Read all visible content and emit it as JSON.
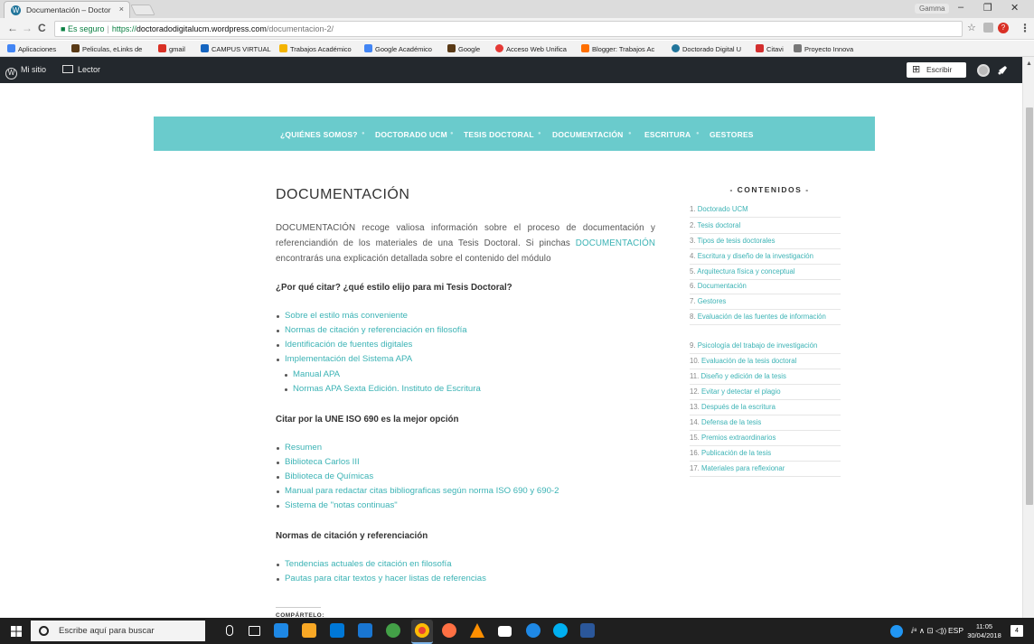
{
  "browser": {
    "tab_title": "Documentación – Doctor",
    "tab_close": "×",
    "profile": "Gamma",
    "win_min": "–",
    "win_max": "❐",
    "win_close": "✕",
    "nav_back": "←",
    "nav_forward": "→",
    "nav_reload": "C",
    "secure_label": "Es seguro",
    "url_scheme": "https://",
    "url_host": "doctoradodigitalucm.wordpress.com",
    "url_path": "/documentacion-2/",
    "star": "☆",
    "menu": "⋮",
    "bookmarks": [
      {
        "label": "Aplicaciones",
        "color": "#4285f4"
      },
      {
        "label": "Peliculas, eLinks de",
        "color": "#5a3a16"
      },
      {
        "label": "gmail",
        "color": "#d93025"
      },
      {
        "label": "CAMPUS VIRTUAL",
        "color": "#1565c0"
      },
      {
        "label": "Trabajos Académico",
        "color": "#f4b400"
      },
      {
        "label": "Google Académico",
        "color": "#4285f4"
      },
      {
        "label": "Google",
        "color": "#5a3a16"
      },
      {
        "label": "Acceso Web Unifica",
        "color": "#e53935"
      },
      {
        "label": "Blogger: Trabajos Ac",
        "color": "#ff6f00"
      },
      {
        "label": "Doctorado Digital U",
        "color": "#21759b"
      },
      {
        "label": "Citavi",
        "color": "#d32f2f"
      },
      {
        "label": "Proyecto Innova",
        "color": "#777777"
      }
    ]
  },
  "wpbar": {
    "my_site": "Mi sitio",
    "reader": "Lector",
    "write": "Escribir"
  },
  "site_nav": [
    "¿QUIÉNES SOMOS?",
    "DOCTORADO UCM",
    "TESIS DOCTORAL",
    "DOCUMENTACIÓN",
    "ESCRITURA",
    "GESTORES"
  ],
  "content": {
    "title": "DOCUMENTACIÓN",
    "intro_pre": "DOCUMENTACIÓN recoge valiosa información sobre el proceso de documentación y referenciandión de los materiales de una Tesis Doctoral. Si pinchas ",
    "intro_link": "DOCUMENTACIÓN",
    "intro_post": " encontrarás una explicación detallada sobre el contenido del módulo",
    "section1_heading": "¿Por qué citar? ¿qué estilo elijo para mi Tesis Doctoral?",
    "section1_items": [
      "Sobre el estilo más conveniente",
      "Normas de citación y referenciación en filosofía",
      "Identificación de fuentes digitales",
      "Implementación del Sistema APA"
    ],
    "section1_subitems": [
      "Manual APA",
      "Normas APA Sexta Edición. Instituto de Escritura"
    ],
    "section2_heading": "Citar por la UNE ISO 690 es la mejor opción",
    "section2_items": [
      "Resumen",
      "Biblioteca Carlos III",
      "Biblioteca de Químicas",
      "Manual para redactar citas bibliograficas según norma ISO 690 y 690-2",
      "Sistema de \"notas continuas\""
    ],
    "section3_heading": "Normas de citación y referenciación",
    "section3_items": [
      "Tendencias actuales de citación en filosofía",
      "Pautas para citar textos y hacer listas de referencias"
    ],
    "share_label": "COMPÁRTELO:"
  },
  "sidebar": {
    "title": "- CONTENIDOS -",
    "items": [
      {
        "n": "1.",
        "label": "Doctorado UCM"
      },
      {
        "n": "2.",
        "label": "Tesis doctoral"
      },
      {
        "n": "3.",
        "label": "Tipos de tesis doctorales"
      },
      {
        "n": "4.",
        "label": "Escritura y diseño de la investigación"
      },
      {
        "n": "5.",
        "label": "Arquitectura física y conceptual"
      },
      {
        "n": "6.",
        "label": "Documentación"
      },
      {
        "n": "7.",
        "label": "Gestores"
      },
      {
        "n": "8.",
        "label": "Evaluación de las fuentes de información"
      },
      {
        "n": "9.",
        "label": "Psicología del trabajo de investigación"
      },
      {
        "n": "10.",
        "label": "Evaluación de la tesis doctoral"
      },
      {
        "n": "11.",
        "label": "Diseño y edición de la tesis"
      },
      {
        "n": "12.",
        "label": "Evitar y detectar el plagio"
      },
      {
        "n": "13.",
        "label": "Después de la escritura"
      },
      {
        "n": "14.",
        "label": "Defensa de la tesis"
      },
      {
        "n": "15.",
        "label": "Premios extraordinarios"
      },
      {
        "n": "16.",
        "label": "Publicación de la tesis"
      },
      {
        "n": "17.",
        "label": "Materiales para reflexionar"
      }
    ]
  },
  "taskbar": {
    "search_placeholder": "Escribe aquí para buscar",
    "lang": "ESP",
    "time": "11:05",
    "date": "30/04/2018",
    "tray_icons": "ⅈ⁸ ∧ ⊡ ◁)) ",
    "notif": "4"
  },
  "colors": {
    "accent": "#6acbcc",
    "link": "#3cb3b5",
    "admin_bar": "#23282d"
  }
}
